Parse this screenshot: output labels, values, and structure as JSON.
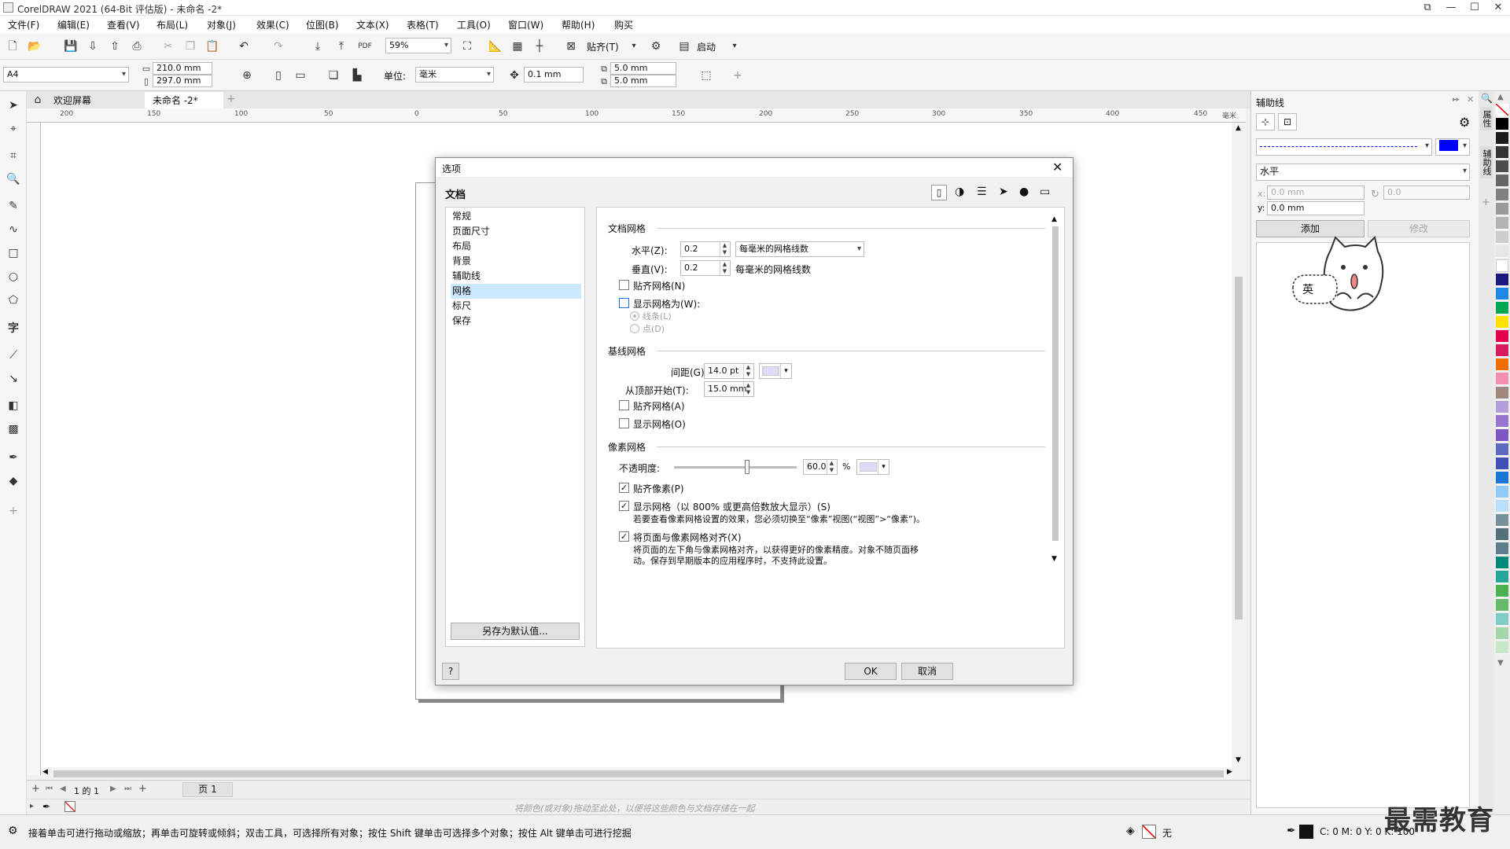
{
  "app": {
    "title": "CorelDRAW 2021 (64-Bit 评估版) - 未命名 -2*"
  },
  "menu": [
    "文件(F)",
    "编辑(E)",
    "查看(V)",
    "布局(L)",
    "对象(J)",
    "效果(C)",
    "位图(B)",
    "文本(X)",
    "表格(T)",
    "工具(O)",
    "窗口(W)",
    "帮助(H)",
    "购买"
  ],
  "toolbar1": {
    "zoom": "59%",
    "snap_label": "贴齐(T)",
    "start_label": "启动"
  },
  "toolbar2": {
    "page_size": "A4",
    "width": "210.0 mm",
    "height": "297.0 mm",
    "unit_label": "单位:",
    "unit_value": "毫米",
    "nudge": "0.1 mm",
    "dup_x": "5.0 mm",
    "dup_y": "5.0 mm"
  },
  "tabs": {
    "welcome": "欢迎屏幕",
    "doc": "未命名 -2*"
  },
  "ruler": {
    "h_ticks": [
      "200",
      "150",
      "100",
      "50",
      "0",
      "50",
      "100",
      "150",
      "200",
      "250",
      "300",
      "350",
      "400",
      "450"
    ],
    "units": "毫米"
  },
  "pagebar": {
    "page_info": "1 的 1",
    "page_tab": "页 1"
  },
  "colorbar": {
    "hint": "将颜色(或对象)拖动至此处，以便将这些颜色与文档存储在一起"
  },
  "status": {
    "message": "接着单击可进行拖动或缩放；再单击可旋转或倾斜；双击工具，可选择所有对象；按住 Shift 键单击可选择多个对象；按住 Alt 键单击可进行挖掘",
    "fill_label": "无",
    "cmyk": "C: 0 M: 0 Y: 0 K: 100"
  },
  "right_panel": {
    "title": "辅助线",
    "orientation": "水平",
    "x_value": "0.0 mm",
    "y_value": "0.0 mm",
    "angle_value": "0.0",
    "add_button": "添加",
    "modify_button": "修改",
    "line_color": "#0000ff",
    "vtabs": [
      "属性",
      "辅助线"
    ],
    "cat_caption": "英"
  },
  "watermark": "最需教育",
  "dialog": {
    "title": "选项",
    "section_title": "文档",
    "nav": [
      "常规",
      "页面尺寸",
      "布局",
      "背景",
      "辅助线",
      "网格",
      "标尺",
      "保存"
    ],
    "nav_selected": 5,
    "save_default": "另存为默认值...",
    "help": "?",
    "ok": "OK",
    "cancel": "取消",
    "doc_grid": {
      "title": "文档网格",
      "h_label": "水平(Z):",
      "h_value": "0.2",
      "h_mode": "每毫米的网格线数",
      "v_label": "垂直(V):",
      "v_value": "0.2",
      "v_mode": "每毫米的网格线数",
      "snap": "贴齐网格(N)",
      "snap_checked": false,
      "show_as": "显示网格为(W):",
      "show_checked": false,
      "opt_lines": "线条(L)",
      "opt_dots": "点(D)"
    },
    "baseline_grid": {
      "title": "基线网格",
      "spacing_label": "间距(G):",
      "spacing_value": "14.0 pt",
      "top_label": "从顶部开始(T):",
      "top_value": "15.0 mm",
      "snap": "贴齐网格(A)",
      "show": "显示网格(O)",
      "color": "#dcdcfa"
    },
    "pixel_grid": {
      "title": "像素网格",
      "opacity_label": "不透明度:",
      "opacity_value": "60.0",
      "opacity_unit": "%",
      "opacity": 0.6,
      "color": "#dcdcfa",
      "snap_pixels": "贴齐像素(P)",
      "show_grid": "显示网格（以 800% 或更高倍数放大显示）(S)",
      "show_note": "若要查看像素网格设置的效果，您必须切换至“像素”视图(“视图”>“像素”)。",
      "align_page": "将页面与像素网格对齐(X)",
      "align_note1": "将页面的左下角与像素网格对齐，以获得更好的像素精度。对象不随页面移",
      "align_note2": "动。保存到早期版本的应用程序时，不支持此设置。"
    }
  }
}
